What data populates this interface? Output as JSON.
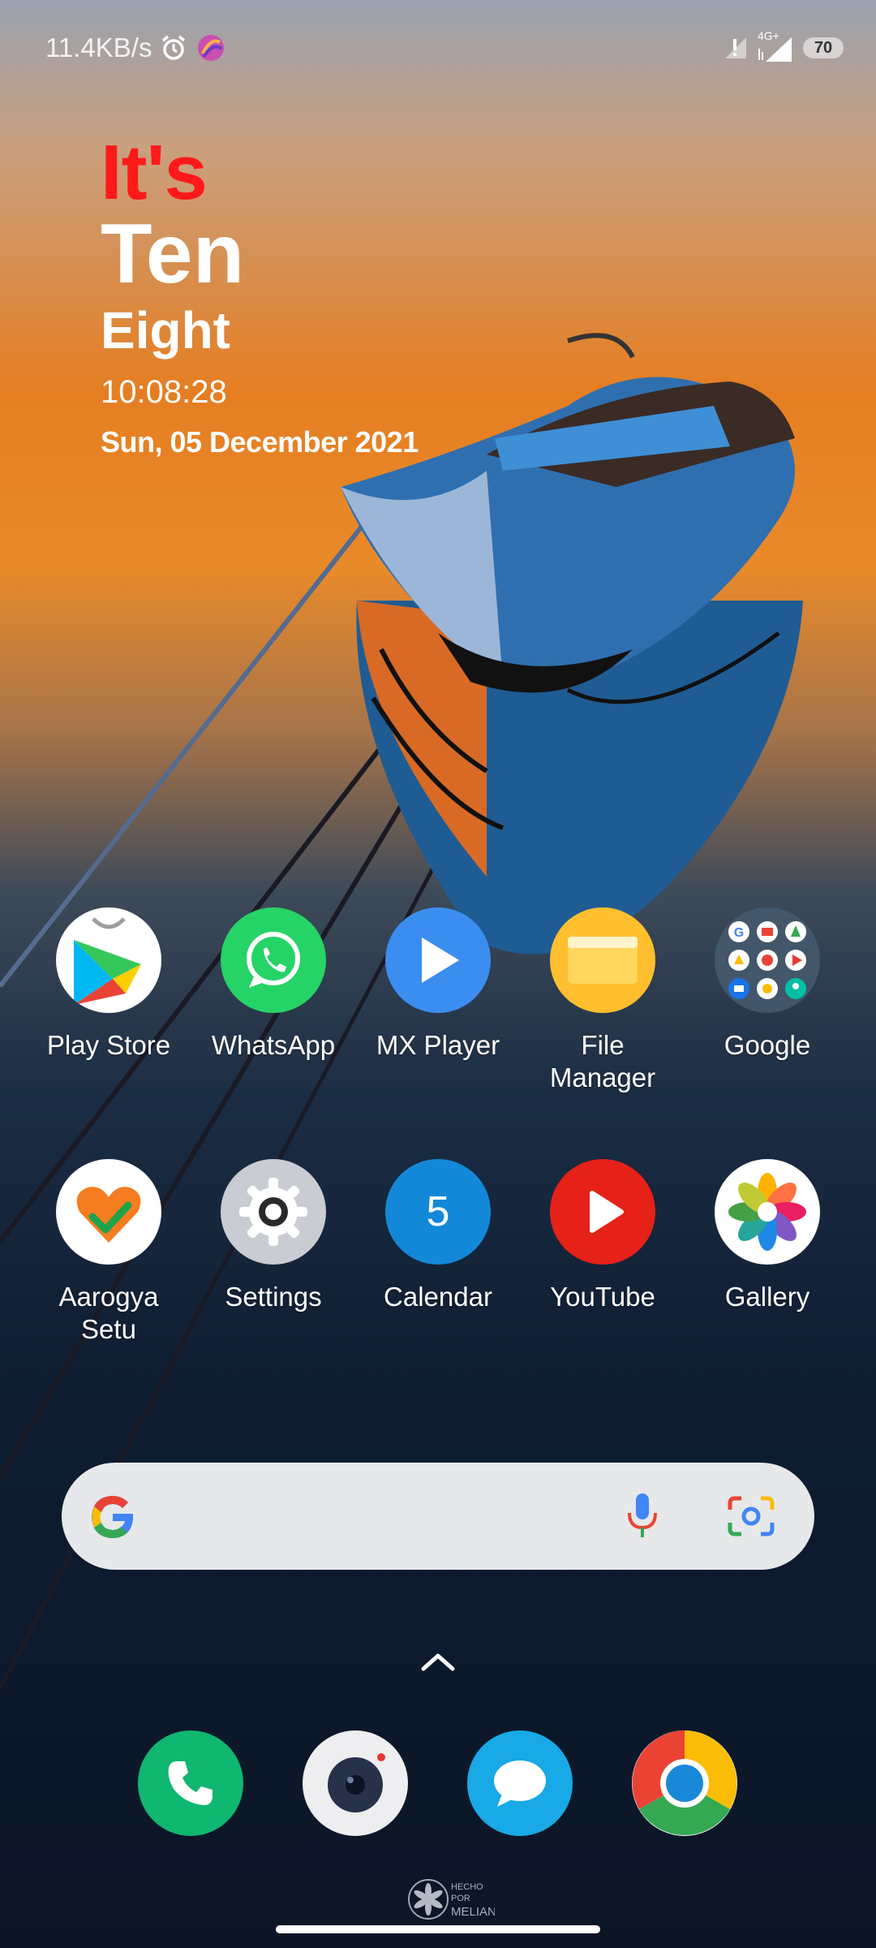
{
  "status_bar": {
    "net_speed": "11.4KB/s",
    "network_type": "4G+",
    "battery": "70"
  },
  "clock_widget": {
    "prefix": "It's",
    "hour_word": "Ten",
    "minute_word": "Eight",
    "digital_time": "10:08:28",
    "date": "Sun, 05 December 2021"
  },
  "apps_row1": [
    {
      "label": "Play Store",
      "icon": "play-store-icon"
    },
    {
      "label": "WhatsApp",
      "icon": "whatsapp-icon"
    },
    {
      "label": "MX Player",
      "icon": "mx-player-icon"
    },
    {
      "label": "File\nManager",
      "icon": "file-manager-icon"
    },
    {
      "label": "Google",
      "icon": "google-folder-icon"
    }
  ],
  "apps_row2": [
    {
      "label": "Aarogya\nSetu",
      "icon": "aarogya-setu-icon"
    },
    {
      "label": "Settings",
      "icon": "settings-gear-icon"
    },
    {
      "label": "Calendar",
      "icon": "calendar-icon",
      "badge": "5"
    },
    {
      "label": "YouTube",
      "icon": "youtube-icon"
    },
    {
      "label": "Gallery",
      "icon": "gallery-icon"
    }
  ],
  "search_bar": {
    "icons": [
      "google-g-icon",
      "microphone-icon",
      "google-lens-icon"
    ]
  },
  "dock": [
    {
      "icon": "phone-icon"
    },
    {
      "icon": "camera-icon"
    },
    {
      "icon": "messages-icon"
    },
    {
      "icon": "chrome-icon"
    }
  ],
  "watermark": {
    "lines": [
      "HECHO",
      "POR",
      "MELIAN"
    ]
  },
  "colors": {
    "clock_accent": "#ff1a1a",
    "whatsapp": "#25d366",
    "mx_player": "#3b8ef0",
    "youtube": "#e62117",
    "phone": "#0fb770",
    "messages": "#18a9e6"
  }
}
